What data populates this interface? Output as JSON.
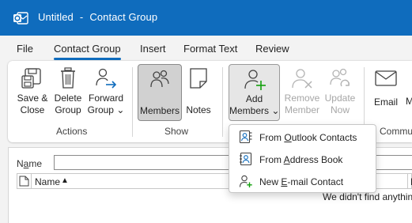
{
  "window": {
    "title": "Untitled",
    "separator": "-",
    "subtitle": "Contact Group"
  },
  "tabs": [
    {
      "label": "File"
    },
    {
      "label": "Contact Group",
      "active": true
    },
    {
      "label": "Insert"
    },
    {
      "label": "Format Text"
    },
    {
      "label": "Review"
    }
  ],
  "ribbon": {
    "actions": {
      "group_label": "Actions",
      "save_close": [
        "Save &",
        "Close"
      ],
      "delete_group": [
        "Delete",
        "Group"
      ],
      "forward_group": [
        "Forward",
        "Group"
      ],
      "forward_chevron": "⌄"
    },
    "show": {
      "group_label": "Show",
      "members": "Members",
      "notes": "Notes"
    },
    "members": {
      "add_members": [
        "Add",
        "Members"
      ],
      "add_chevron": "⌄",
      "remove_member": [
        "Remove",
        "Member"
      ],
      "update_now": [
        "Update",
        "Now"
      ]
    },
    "communicate": {
      "group_label": "Commun",
      "email": "Email",
      "meeting_partial": "M"
    }
  },
  "form": {
    "name_label_prefix": "N",
    "name_label_underlined": "a",
    "name_label_suffix": "me",
    "name_value": ""
  },
  "list": {
    "col_name": "Name",
    "sort_indicator": "▲",
    "col_partial": "E",
    "empty_message": "We didn't find anythin"
  },
  "add_members_menu": [
    {
      "pre": "From ",
      "u": "O",
      "post": "utlook Contacts",
      "icon": "outlook-contacts-icon"
    },
    {
      "pre": "From ",
      "u": "A",
      "post": "ddress Book",
      "icon": "address-book-icon"
    },
    {
      "pre": "New ",
      "u": "E",
      "post": "-mail Contact",
      "icon": "new-email-contact-icon"
    }
  ],
  "colors": {
    "title_bar": "#0f6cbd",
    "accent": "#0f6cbd",
    "add_green": "#13a10e"
  }
}
